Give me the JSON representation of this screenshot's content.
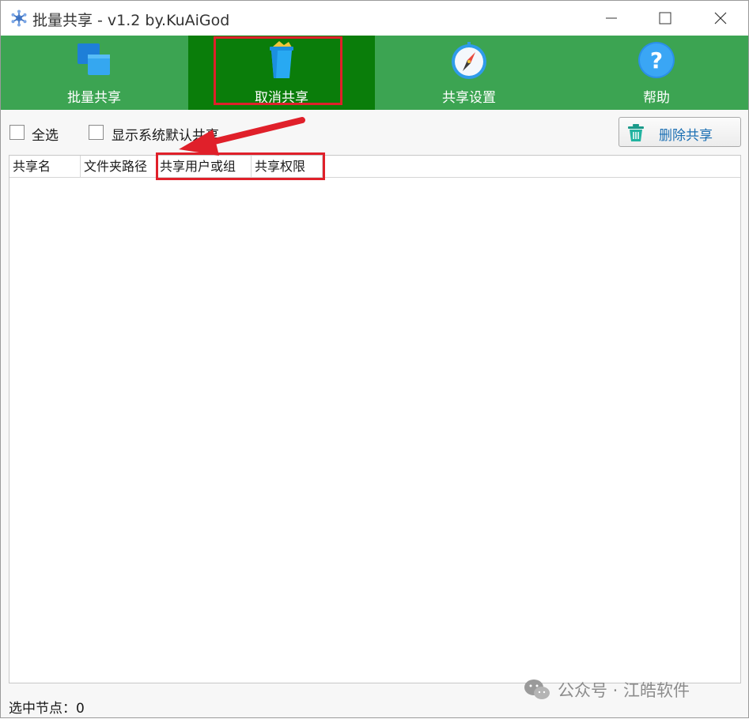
{
  "window": {
    "title": "批量共享 - v1.2 by.KuAiGod"
  },
  "toolbar": {
    "items": [
      {
        "label": "批量共享",
        "icon": "windows-stack-icon"
      },
      {
        "label": "取消共享",
        "icon": "recycle-bin-icon",
        "active": true
      },
      {
        "label": "共享设置",
        "icon": "compass-icon"
      },
      {
        "label": "帮助",
        "icon": "help-icon"
      }
    ],
    "bg_color": "#3ca452",
    "active_color": "#0a7d0a"
  },
  "options": {
    "select_all": {
      "label": "全选",
      "checked": false
    },
    "show_default": {
      "label": "显示系统默认共享",
      "checked": false
    },
    "delete_button": "删除共享"
  },
  "list": {
    "columns": [
      "共享名",
      "文件夹路径",
      "共享用户或组",
      "共享权限"
    ],
    "rows": []
  },
  "status": {
    "selected_label": "选中节点：",
    "selected_count": "0"
  },
  "watermark": {
    "text": "公众号 · 江皓软件"
  },
  "annotation_color": "#e0202a"
}
